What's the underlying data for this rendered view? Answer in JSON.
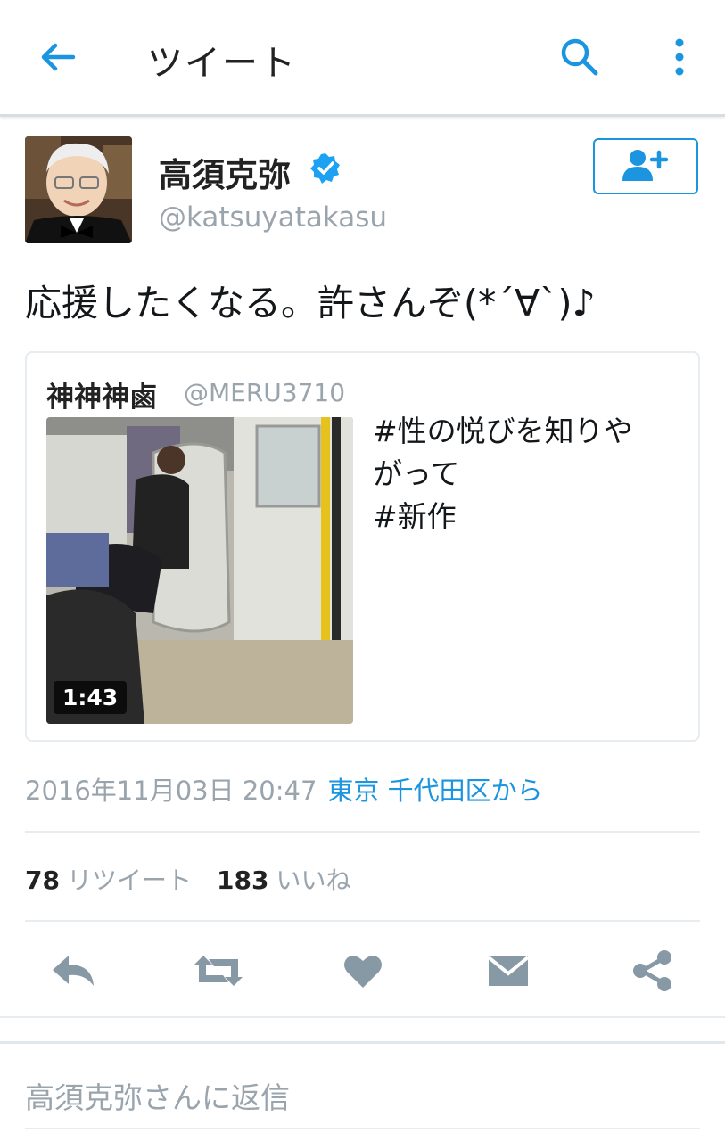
{
  "header": {
    "title": "ツイート",
    "back_icon": "back-arrow-icon",
    "search_icon": "search-icon",
    "more_icon": "more-vertical-icon",
    "accent": "#1b95e0"
  },
  "author": {
    "name": "高須克弥",
    "handle": "@katsuyatakasu",
    "verified": true,
    "follow_icon": "add-user-icon"
  },
  "tweet": {
    "text": "応援したくなる。許さんぞ(*´∀`)♪"
  },
  "quoted": {
    "name": "神神神鹵",
    "handle": "@MERU3710",
    "text": "#性の悦びを知りや\nがって\n#新作",
    "duration": "1:43"
  },
  "meta": {
    "date": "2016年11月03日 20:47",
    "location": "東京 千代田区から"
  },
  "stats": {
    "retweets": "78",
    "retweets_label": "リツイート",
    "likes": "183",
    "likes_label": "いいね"
  },
  "actions": [
    "reply-icon",
    "retweet-icon",
    "like-icon",
    "message-icon",
    "share-icon"
  ],
  "reply": {
    "placeholder": "高須克弥さんに返信"
  }
}
